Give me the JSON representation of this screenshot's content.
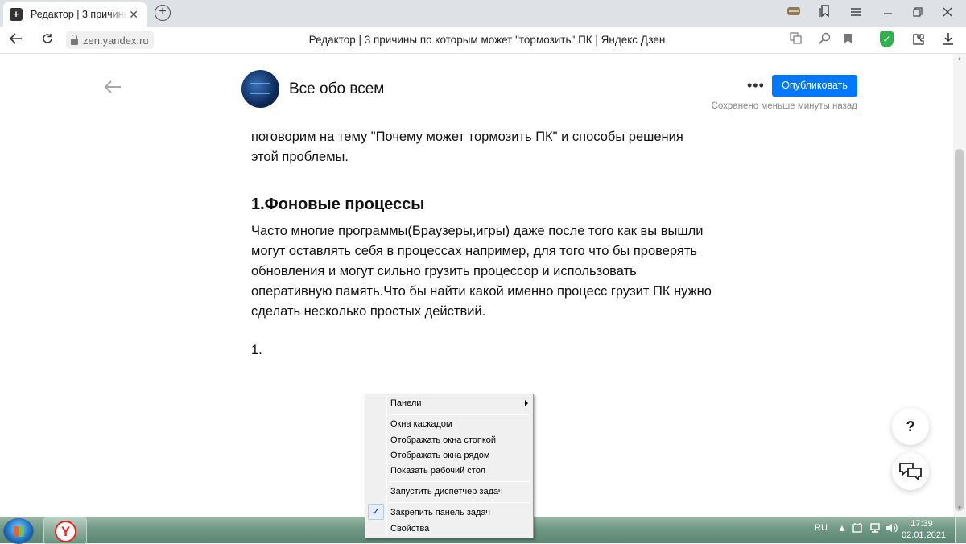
{
  "browser": {
    "tab_title": "Редактор | 3 причины по которым может \"тормозить\" ПК | Яндекс Дзен",
    "tab_close": "✕",
    "new_tab": "+",
    "url": "zen.yandex.ru",
    "page_title": "Редактор | 3 причины по которым может \"тормозить\" ПК | Яндекс Дзен",
    "shield_glyph": "✓"
  },
  "editor": {
    "channel_name": "Все обо всем",
    "more": "•••",
    "publish_label": "Опубликовать",
    "saved_status": "Сохранено меньше минуты назад",
    "intro_line1": "поговорим на тему \"Почему может тормозить ПК\" и способы решения",
    "intro_line2": "этой проблемы.",
    "heading": "1.Фоновые процессы",
    "body_lines": [
      "Часто многие программы(Браузеры,игры) даже после того как вы вышли",
      "могут оставлять себя в процессах например, для того что бы проверять",
      "обновления и могут сильно грузить процессор и использовать",
      "оперативную память.Что бы найти какой именно процесс грузит ПК нужно",
      "сделать несколько простых действий."
    ],
    "list_marker": "1."
  },
  "help_button": "?",
  "context_menu": {
    "panels": "Панели",
    "cascade": "Окна каскадом",
    "stack": "Отображать окна стопкой",
    "side_by_side": "Отображать окна рядом",
    "show_desktop": "Показать рабочий стол",
    "task_manager": "Запустить диспетчер задач",
    "lock_taskbar": "Закрепить панель задач",
    "lock_taskbar_checked": true,
    "properties": "Свойства",
    "check_glyph": "✓"
  },
  "taskbar": {
    "app_letter": "Y",
    "language": "RU",
    "time": "17:39",
    "date": "02.01.2021"
  },
  "icons": {
    "tab_favicon": "plus-square-icon",
    "back": "arrow-left-icon",
    "reload": "reload-icon",
    "lock": "lock-icon",
    "translate": "translate-icon",
    "zoom": "zoom-icon",
    "bookmark": "bookmark-icon",
    "protect": "shield-icon",
    "extensions": "extensions-icon",
    "download": "download-icon",
    "feedback": "chat-icon"
  },
  "colors": {
    "publish_button": "#0077ff",
    "protect_shield": "#2fb24c",
    "taskbar": "#6e9784",
    "tab_strip": "#dee1e6"
  }
}
